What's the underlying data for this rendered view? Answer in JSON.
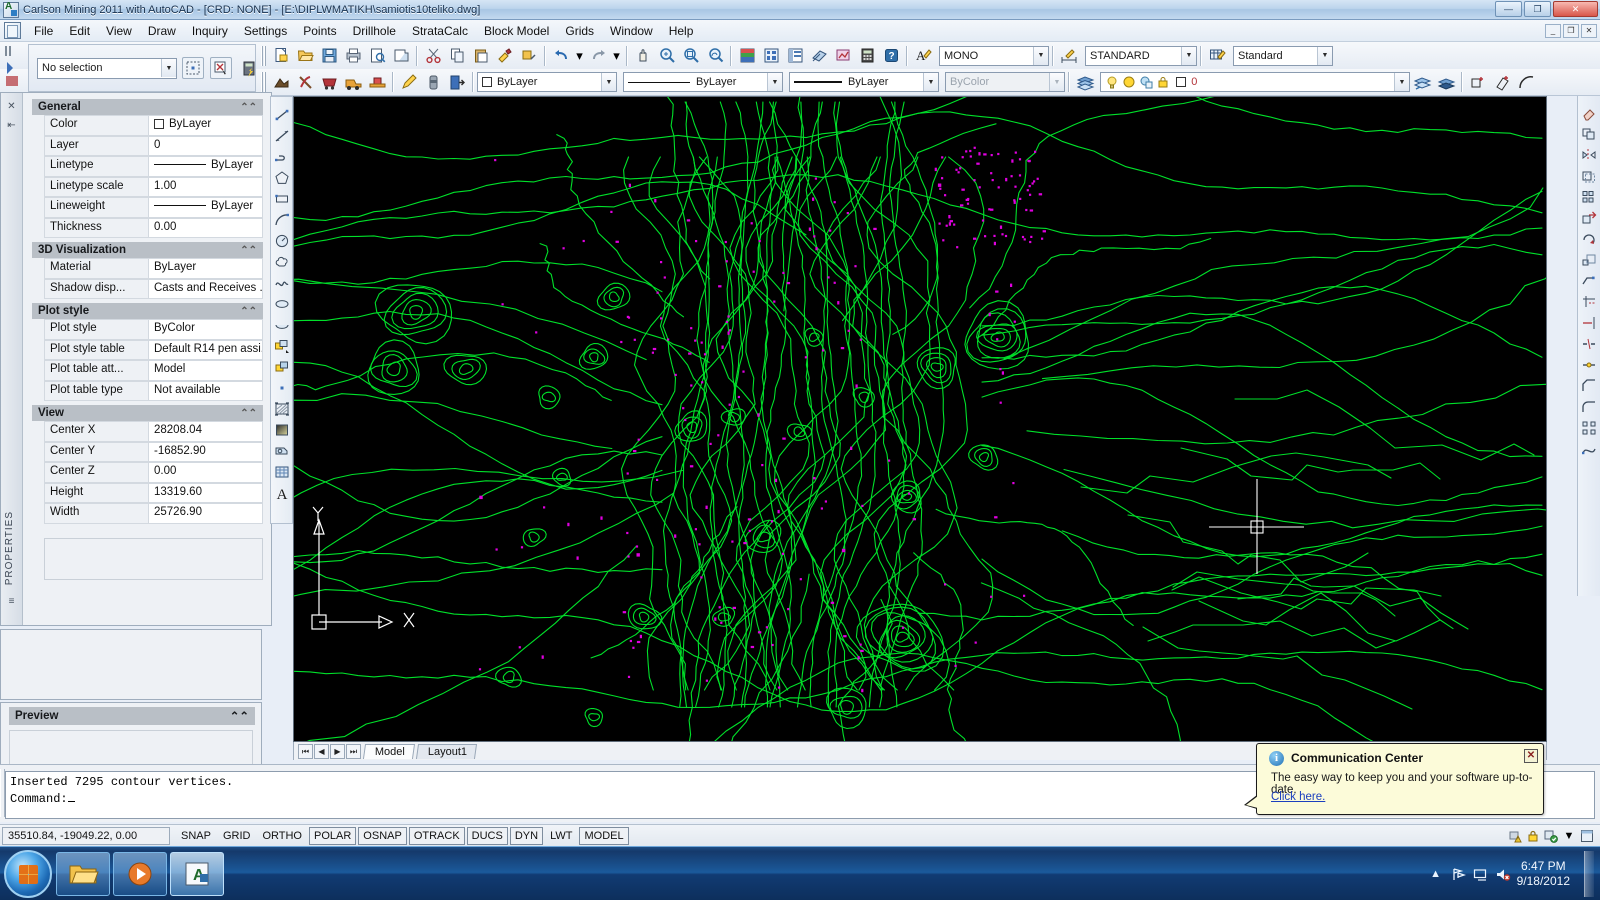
{
  "window": {
    "title": "Carlson Mining 2011 with AutoCAD - [CRD: NONE] - [E:\\DIPLWMATIKH\\samiotis10teliko.dwg]",
    "minimize": "—",
    "maximize": "❐",
    "close": "✕",
    "inner_minimize": "_",
    "inner_restore": "❐",
    "inner_close": "✕"
  },
  "menubar": {
    "items": [
      "File",
      "Edit",
      "View",
      "Draw",
      "Inquiry",
      "Settings",
      "Points",
      "Drillhole",
      "StrataCalc",
      "Block Model",
      "Grids",
      "Window",
      "Help"
    ]
  },
  "toolbars": {
    "selection": {
      "value": "No selection",
      "buttons": [
        "quick-select",
        "deselect",
        "quick-calc"
      ]
    },
    "standard_icons": [
      "qnew",
      "open",
      "save",
      "plot",
      "plot-preview",
      "publish",
      "cut",
      "copy",
      "paste",
      "match-properties",
      "block-editor",
      "undo",
      "redo",
      "pan",
      "zoom-realtime",
      "zoom-window",
      "zoom-previous",
      "properties",
      "design-center",
      "tool-palettes",
      "sheet-set",
      "markup",
      "calculator",
      "help"
    ],
    "mining_icons": [
      "mine-model",
      "pick",
      "mine-cart",
      "haul-truck",
      "loader"
    ],
    "styles": {
      "text_style": "MONO",
      "dim_style": "STANDARD",
      "table_style": "Standard"
    },
    "properties": {
      "color": "ByLayer",
      "linetype": "ByLayer",
      "lineweight": "ByLayer",
      "plotstyle": "ByColor"
    },
    "layer": {
      "current": "0",
      "icons": [
        "lightbulb-on-icon",
        "sun-icon",
        "freeze-icon",
        "lock-icon",
        "color-swatch-icon"
      ]
    }
  },
  "properties_palette": {
    "vertical_label": "PROPERTIES",
    "sections": [
      {
        "name": "General",
        "rows": [
          {
            "key": "Color",
            "value": "ByLayer",
            "kind": "swatch"
          },
          {
            "key": "Layer",
            "value": "0",
            "kind": "text"
          },
          {
            "key": "Linetype",
            "value": "ByLayer",
            "kind": "line"
          },
          {
            "key": "Linetype scale",
            "value": "1.00",
            "kind": "text"
          },
          {
            "key": "Lineweight",
            "value": "ByLayer",
            "kind": "line"
          },
          {
            "key": "Thickness",
            "value": "0.00",
            "kind": "text"
          }
        ]
      },
      {
        "name": "3D Visualization",
        "rows": [
          {
            "key": "Material",
            "value": "ByLayer",
            "kind": "text"
          },
          {
            "key": "Shadow disp...",
            "value": "Casts and Receives ...",
            "kind": "text"
          }
        ]
      },
      {
        "name": "Plot style",
        "rows": [
          {
            "key": "Plot style",
            "value": "ByColor",
            "kind": "text"
          },
          {
            "key": "Plot style table",
            "value": "Default R14 pen assi...",
            "kind": "text"
          },
          {
            "key": "Plot table att...",
            "value": "Model",
            "kind": "text"
          },
          {
            "key": "Plot table type",
            "value": "Not available",
            "kind": "text"
          }
        ]
      },
      {
        "name": "View",
        "rows": [
          {
            "key": "Center X",
            "value": "28208.04",
            "kind": "text"
          },
          {
            "key": "Center Y",
            "value": "-16852.90",
            "kind": "text"
          },
          {
            "key": "Center Z",
            "value": "0.00",
            "kind": "text"
          },
          {
            "key": "Height",
            "value": "13319.60",
            "kind": "text"
          },
          {
            "key": "Width",
            "value": "25726.90",
            "kind": "text"
          }
        ]
      }
    ]
  },
  "preview_panel": {
    "title": "Preview"
  },
  "draw_toolbar": {
    "icons": [
      "line-icon",
      "construction-line-icon",
      "polyline-icon",
      "polygon-icon",
      "rectangle-icon",
      "arc-icon",
      "circle-icon",
      "revision-cloud-icon",
      "spline-icon",
      "ellipse-icon",
      "ellipse-arc-icon",
      "insert-block-icon",
      "make-block-icon",
      "point-icon",
      "hatch-icon",
      "gradient-icon",
      "region-icon",
      "table-icon",
      "multiline-text-icon"
    ]
  },
  "right_toolbar": {
    "icons": [
      "erase-icon",
      "copy-icon",
      "mirror-icon",
      "offset-icon",
      "array-icon",
      "move-icon",
      "rotate-icon",
      "scale-icon",
      "stretch-icon",
      "trim-icon",
      "extend-icon",
      "break-icon",
      "join-icon",
      "chamfer-icon",
      "fillet-icon",
      "explode-icon",
      "edit-polyline-icon"
    ]
  },
  "drawing": {
    "ucs": {
      "x_label": "X",
      "y_label": "Y"
    },
    "contour_color": "#00e02a",
    "point_color": "#e000e0",
    "background": "#000000",
    "crosshair_color": "#ffffff"
  },
  "layout_tabs": {
    "nav": [
      "⏮",
      "◀",
      "▶",
      "⏭"
    ],
    "tabs": [
      {
        "label": "Model",
        "active": true
      },
      {
        "label": "Layout1",
        "active": false
      }
    ]
  },
  "command_line": {
    "history": "Inserted 7295 contour vertices.",
    "prompt": "Command:"
  },
  "status_bar": {
    "coordinates": "35510.84, -19049.22, 0.00",
    "toggles": [
      {
        "label": "SNAP",
        "framed": false
      },
      {
        "label": "GRID",
        "framed": false
      },
      {
        "label": "ORTHO",
        "framed": false
      },
      {
        "label": "POLAR",
        "framed": true
      },
      {
        "label": "OSNAP",
        "framed": true
      },
      {
        "label": "OTRACK",
        "framed": true
      },
      {
        "label": "DUCS",
        "framed": true
      },
      {
        "label": "DYN",
        "framed": true
      },
      {
        "label": "LWT",
        "framed": false
      },
      {
        "label": "MODEL",
        "framed": true
      }
    ],
    "tray_icons": [
      "warning-icon",
      "lock-icon",
      "annotation-scale-icon",
      "chevron-down-icon",
      "maximize-icon"
    ]
  },
  "balloon": {
    "title": "Communication Center",
    "body": "The easy way to keep you and your software up-to-date.",
    "link": "Click here.",
    "close": "✕",
    "info_glyph": "i"
  },
  "taskbar": {
    "apps": [
      "file-explorer-icon",
      "media-player-icon",
      "autocad-icon"
    ],
    "tray": [
      "chevron-up-icon",
      "network-icon",
      "display-icon",
      "volume-muted-icon"
    ],
    "clock_time": "6:47 PM",
    "clock_date": "9/18/2012"
  }
}
